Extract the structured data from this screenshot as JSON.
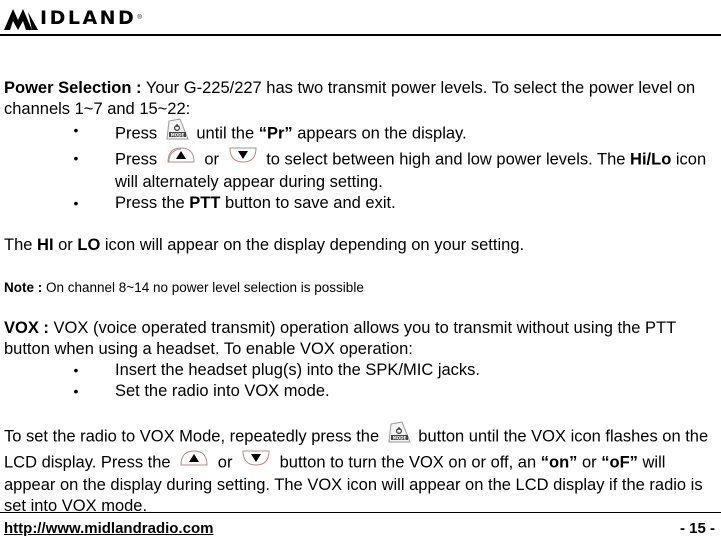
{
  "header": {
    "brand": "IDLAND",
    "brand_full": "MIDLAND",
    "registered_mark": "®"
  },
  "power_selection": {
    "heading": "Power Selection :",
    "intro": " Your G-225/227 has two transmit power levels. To select the power level on channels 1~7 and 15~22:",
    "bullets": [
      {
        "pre": "Press ",
        "icon": "mode-button-icon",
        "mid": " until the ",
        "bold": "“Pr”",
        "post": " appears on the display."
      },
      {
        "pre": "Press ",
        "icon1": "up-arrow-button-icon",
        "or": " or ",
        "icon2": "down-arrow-button-icon",
        "post": " to select between high and low power levels. The ",
        "bold": "Hi/Lo",
        "post2": " icon will alternately appear during setting."
      },
      {
        "pre": "Press the ",
        "bold": "PTT",
        "post": " button to save and exit."
      }
    ]
  },
  "hi_lo_line": {
    "pre": "The ",
    "hi": "HI",
    "or": " or ",
    "lo": "LO",
    "post": " icon will appear on the display depending on your setting."
  },
  "note": {
    "label": "Note :",
    "text": " On channel 8~14 no power level selection is possible"
  },
  "vox": {
    "heading": "VOX :",
    "intro": " VOX (voice operated transmit) operation allows you to transmit without using the PTT button when using a headset. To enable VOX operation:",
    "bullets": [
      "Insert the headset plug(s) into the SPK/MIC jacks.",
      "Set the radio into VOX mode."
    ],
    "para": {
      "part1": "To set the radio to VOX Mode, repeatedly  press  the ",
      "part2": " button until the VOX icon flashes on the LCD display. Press the ",
      "or": " or ",
      "part3": " button to turn the VOX on or off, an ",
      "on": "“on”",
      "or2": " or ",
      "off": "“oF”",
      "part4": " will appear on the display during setting. The VOX icon will appear on the LCD display if the radio is set into VOX mode."
    }
  },
  "footer": {
    "link": "http://www.midlandradio.com",
    "page": "- 15 -"
  },
  "icons": {
    "mode_label": "MODE",
    "bullet": "•"
  }
}
